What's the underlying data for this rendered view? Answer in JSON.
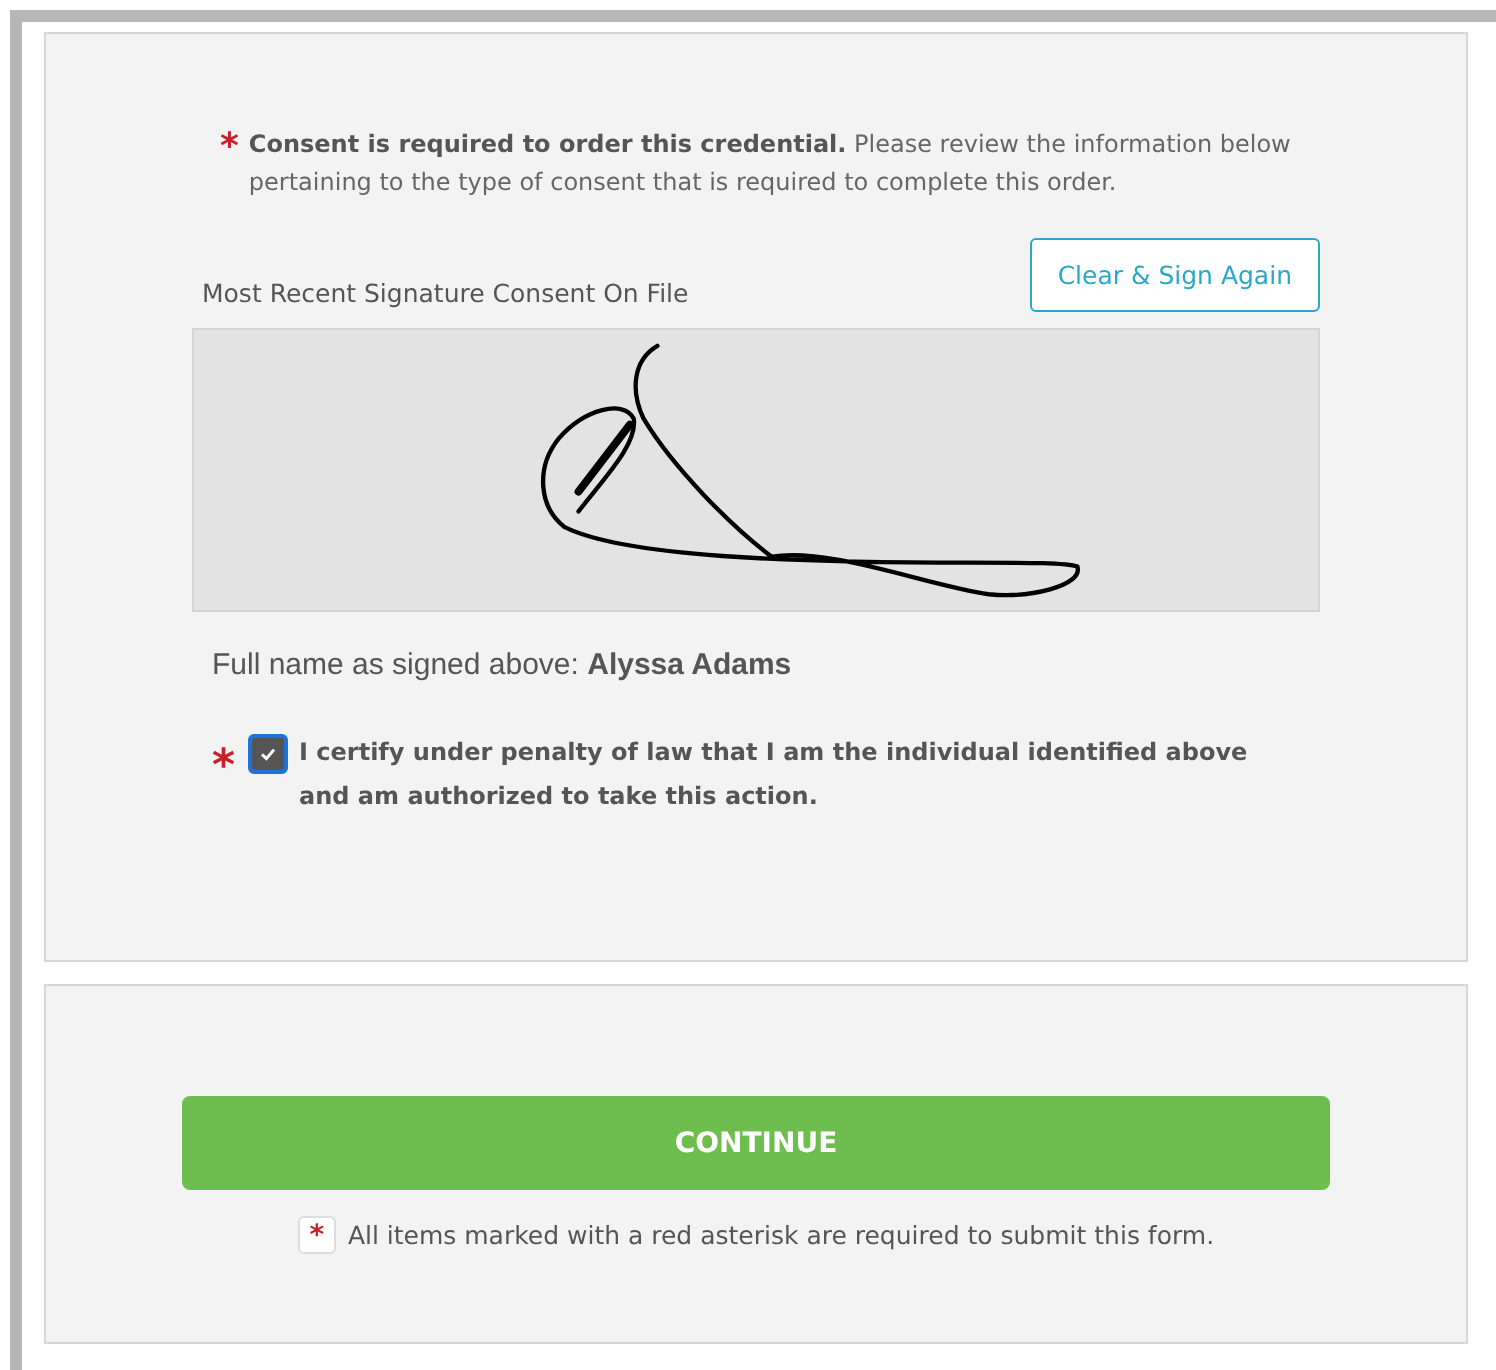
{
  "consent_notice": {
    "marker": "*",
    "text": "**Consent is required to order this credential.** Please review the information below pertaining to the type of consent that is required to complete this order."
  },
  "signature": {
    "label": "Most Recent Signature Consent On File",
    "clear_button": "Clear & Sign Again",
    "full_name_label": "Full name as signed above:",
    "full_name": "Alyssa Adams"
  },
  "certification": {
    "marker": "*",
    "checked": true,
    "text": "I certify under penalty of law that I am the individual identified above and am authorized to take this action."
  },
  "continue_button": "CONTINUE",
  "required_note": {
    "marker": "*",
    "text": "All items marked with a red asterisk are required to submit this form."
  }
}
